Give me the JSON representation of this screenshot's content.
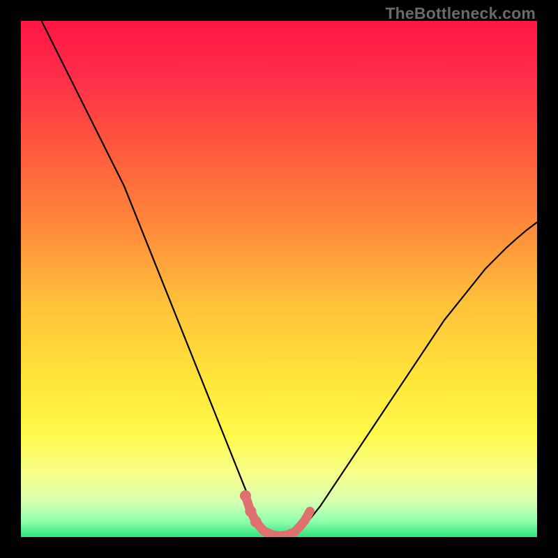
{
  "watermark": "TheBottleneck.com",
  "colors": {
    "frame": "#000000",
    "curve": "#000000",
    "marker": "#e07070",
    "gradient_stops": [
      {
        "offset": 0.0,
        "color": "#ff1744"
      },
      {
        "offset": 0.1,
        "color": "#ff2b49"
      },
      {
        "offset": 0.25,
        "color": "#ff5a3c"
      },
      {
        "offset": 0.4,
        "color": "#ff8a3a"
      },
      {
        "offset": 0.55,
        "color": "#ffc23a"
      },
      {
        "offset": 0.7,
        "color": "#ffe63a"
      },
      {
        "offset": 0.8,
        "color": "#fff94a"
      },
      {
        "offset": 0.88,
        "color": "#f6ff8c"
      },
      {
        "offset": 0.93,
        "color": "#d9ffb0"
      },
      {
        "offset": 0.97,
        "color": "#8effac"
      },
      {
        "offset": 1.0,
        "color": "#2fe37a"
      }
    ]
  },
  "chart_data": {
    "type": "line",
    "title": "",
    "xlabel": "",
    "ylabel": "",
    "xlim": [
      0,
      100
    ],
    "ylim": [
      0,
      100
    ],
    "series": [
      {
        "name": "bottleneck-curve",
        "x": [
          4,
          6,
          8,
          10,
          12,
          14,
          16,
          18,
          20,
          22,
          24,
          26,
          28,
          30,
          32,
          34,
          36,
          38,
          40,
          42,
          44,
          45,
          46,
          47,
          48,
          49,
          50,
          51,
          52,
          53,
          54,
          56,
          58,
          60,
          62,
          64,
          66,
          68,
          70,
          72,
          74,
          76,
          78,
          80,
          82,
          84,
          86,
          88,
          90,
          92,
          94,
          96,
          98,
          100
        ],
        "y": [
          100,
          96,
          92,
          88,
          84,
          80,
          76,
          72,
          68,
          63,
          58,
          53,
          48,
          43,
          38,
          33,
          28,
          23,
          18,
          13,
          8,
          5,
          3,
          1.5,
          0.8,
          0.3,
          0.1,
          0.1,
          0.3,
          0.8,
          1.5,
          3.5,
          6,
          9,
          12,
          15,
          18,
          21,
          24,
          27,
          30,
          33,
          36,
          39,
          42,
          44.5,
          47,
          49.5,
          52,
          54,
          56,
          57.8,
          59.5,
          61
        ]
      }
    ],
    "markers": {
      "name": "trough-markers",
      "x": [
        43.5,
        44.5,
        45.5,
        47,
        48.5,
        50,
        51.5,
        53,
        54,
        55,
        56
      ],
      "y": [
        8,
        5,
        3,
        1.2,
        0.5,
        0.2,
        0.4,
        1.0,
        2.0,
        3.2,
        5.0
      ]
    }
  }
}
